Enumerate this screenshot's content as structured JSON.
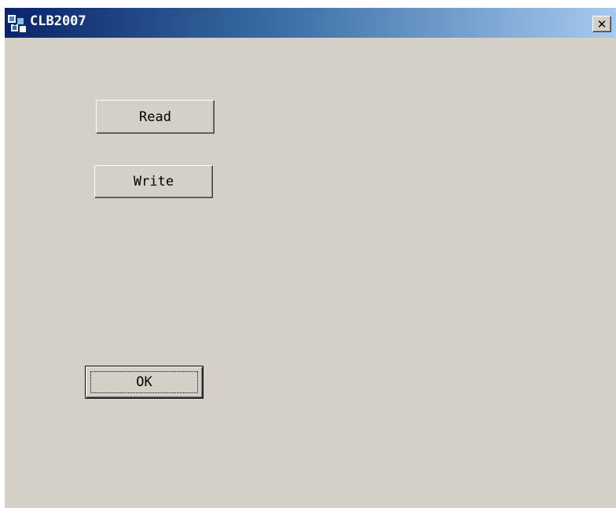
{
  "window": {
    "title": "CLB2007",
    "close_label": "✕"
  },
  "buttons": {
    "read_label": "Read",
    "write_label": "Write",
    "ok_label": "OK"
  },
  "icons": {
    "app": "application-icon",
    "close": "close-icon"
  }
}
